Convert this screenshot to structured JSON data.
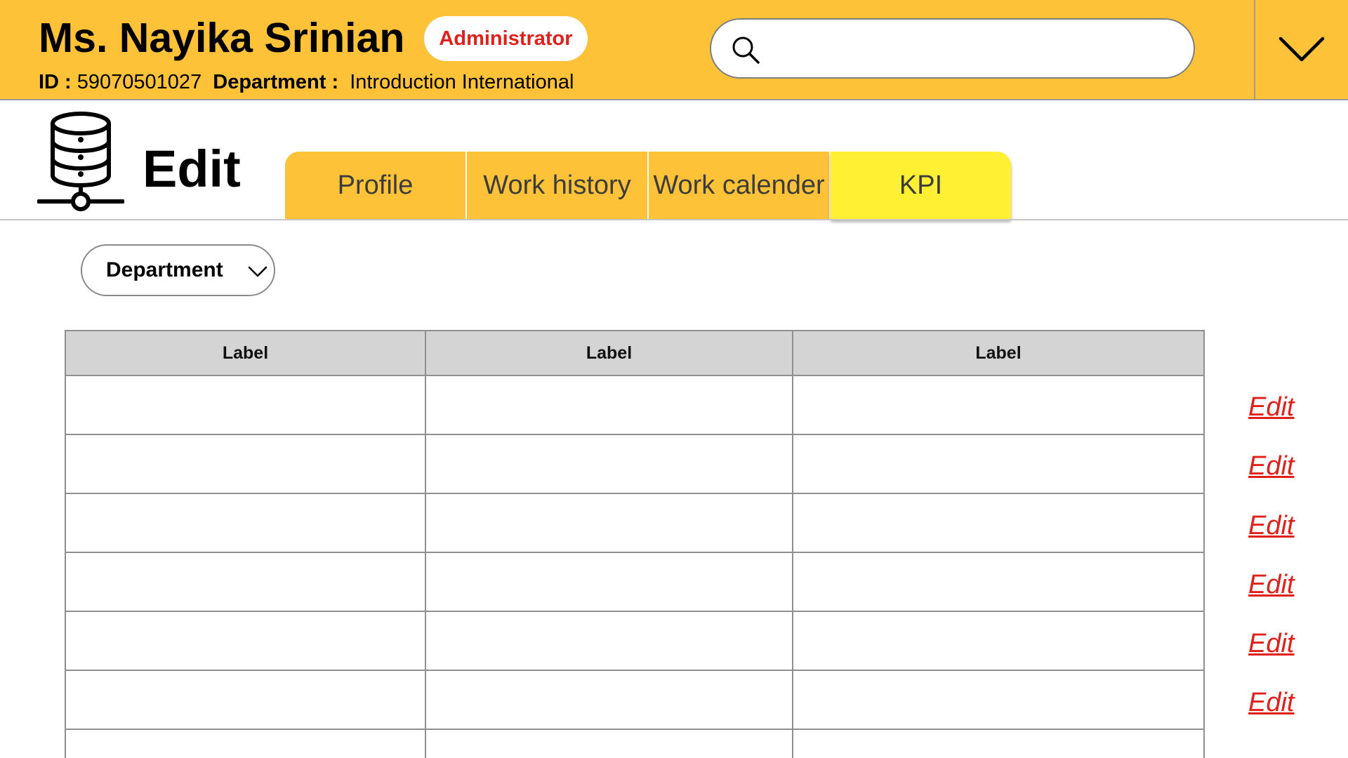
{
  "header": {
    "user_name": "Ms. Nayika Srinian",
    "role_badge": "Administrator",
    "id_label": "ID :",
    "id_value": "59070501027",
    "department_label": "Department :",
    "department_value": "Introduction International",
    "search": {
      "value": "",
      "placeholder": ""
    },
    "brand_color": "#fec238",
    "badge_text_color": "#e0201b"
  },
  "page": {
    "title": "Edit",
    "icon": "database-network-icon"
  },
  "tabs": [
    {
      "label": "Profile",
      "active": false
    },
    {
      "label": "Work history",
      "active": false
    },
    {
      "label": "Work calender",
      "active": false
    },
    {
      "label": "KPI",
      "active": true
    }
  ],
  "filters": {
    "department_select": "Department"
  },
  "table": {
    "columns": [
      "Label",
      "Label",
      "Label"
    ],
    "rows": [
      [
        "",
        "",
        ""
      ],
      [
        "",
        "",
        ""
      ],
      [
        "",
        "",
        ""
      ],
      [
        "",
        "",
        ""
      ],
      [
        "",
        "",
        ""
      ],
      [
        "",
        "",
        ""
      ]
    ],
    "row_action_label": "Edit",
    "header_bg": "#d4d4d4"
  },
  "colors": {
    "active_tab": "#fff033",
    "link": "#e0201b"
  }
}
